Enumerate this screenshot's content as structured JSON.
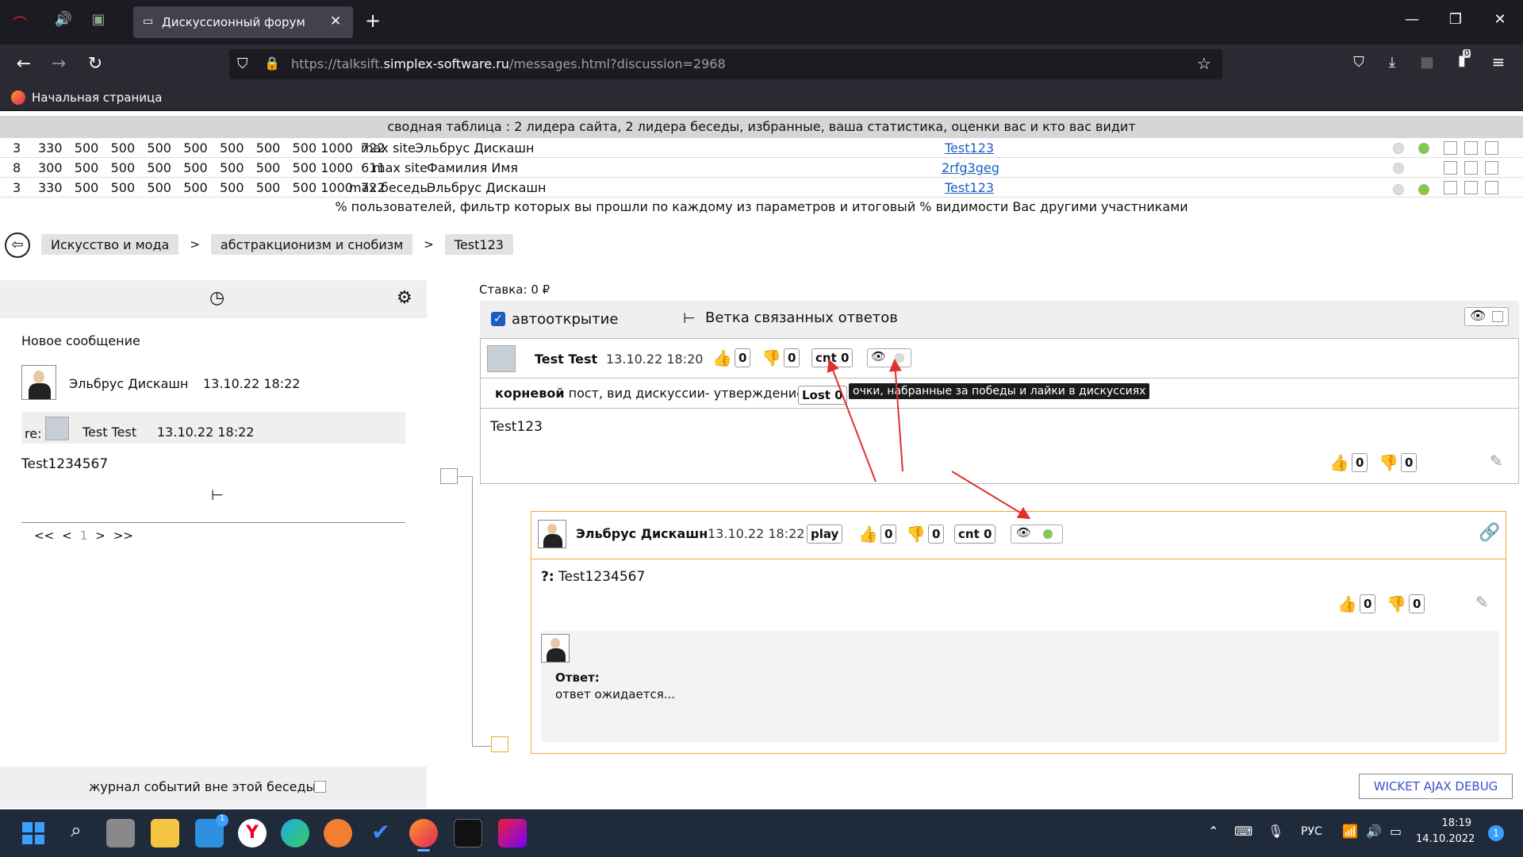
{
  "browser": {
    "tab_title": "Дискуссионный форум",
    "url_prefix": "https://talksift.",
    "url_domain": "simplex-software.ru",
    "url_path": "/messages.html?discussion=2968",
    "bookmark": "Начальная страница",
    "extension_badge": "0"
  },
  "summary": {
    "title": "сводная таблица : 2 лидера сайта, 2 лидера беседы, избранные, ваша статистика, оценки вас и кто вас видит",
    "rows": [
      {
        "rank": "3",
        "nums": "330   500   500   500   500   500   500   500 1000  722",
        "kind": "max site",
        "name": "Эльбрус Дискашн",
        "link": "Test123",
        "dot2": true
      },
      {
        "rank": "8",
        "nums": "300   500   500   500   500   500   500   500 1000  611",
        "kind": "max site",
        "name": "Фамилия Имя",
        "link": "2rfg3geg",
        "dot2": false
      },
      {
        "rank": "3",
        "nums": "330   500   500   500   500   500   500   500 1000  722",
        "kind": "max беседы",
        "name": "Эльбрус Дискашн",
        "link": "Test123",
        "dot2": true
      }
    ],
    "footer": "% пользователей, фильтр которых вы прошли по каждому из параметров и итоговый % видимости Вас другими участниками"
  },
  "breadcrumbs": [
    "Искусство и мода",
    "абстракционизм и снобизм",
    "Test123"
  ],
  "breadcrumb_sep": ">",
  "left": {
    "new_message": "Новое сообщение",
    "author": "Эльбрус Дискашн",
    "date": "13.10.22 18:22",
    "re_label": "re:",
    "re_author": "Test Test",
    "re_date": "13.10.22 18:22",
    "text": "Test1234567",
    "pager": {
      "first": "<<",
      "prev": "<",
      "page": "1",
      "next": ">",
      "last": ">>"
    },
    "journal_label": "журнал событий вне этой беседы"
  },
  "right": {
    "stake": "Ставка: 0 ₽",
    "autoopen": "автооткрытие",
    "branch": "Ветка связанных ответов",
    "post1": {
      "author": "Test Test",
      "date": "13.10.22 18:20",
      "likes": "0",
      "dislikes": "0",
      "cnt": "cnt 0",
      "root_bold": "корневой",
      "root_text": " пост, вид дискуссии- утверждение",
      "lost": "Lost 0",
      "tooltip": "очки, набранные за победы и лайки в дискуссиях",
      "body": "Test123",
      "b_likes": "0",
      "b_dislikes": "0"
    },
    "post2": {
      "author": "Эльбрус Дискашн",
      "date": "13.10.22 18:22",
      "play": "play",
      "likes": "0",
      "dislikes": "0",
      "cnt": "cnt 0",
      "q_prefix": "?:",
      "body": " Test1234567",
      "b_likes": "0",
      "b_dislikes": "0",
      "answer_label": "Ответ:",
      "answer_text": "ответ ожидается..."
    },
    "debug": "WICKET AJAX DEBUG"
  },
  "taskbar": {
    "lang": "РУС",
    "time": "18:19",
    "date": "14.10.2022",
    "notif": "1",
    "mail_badge": "1"
  },
  "colors": {
    "accent_orange": "#f0a830",
    "link": "#1a5ec4",
    "arrow": "#e03030"
  }
}
